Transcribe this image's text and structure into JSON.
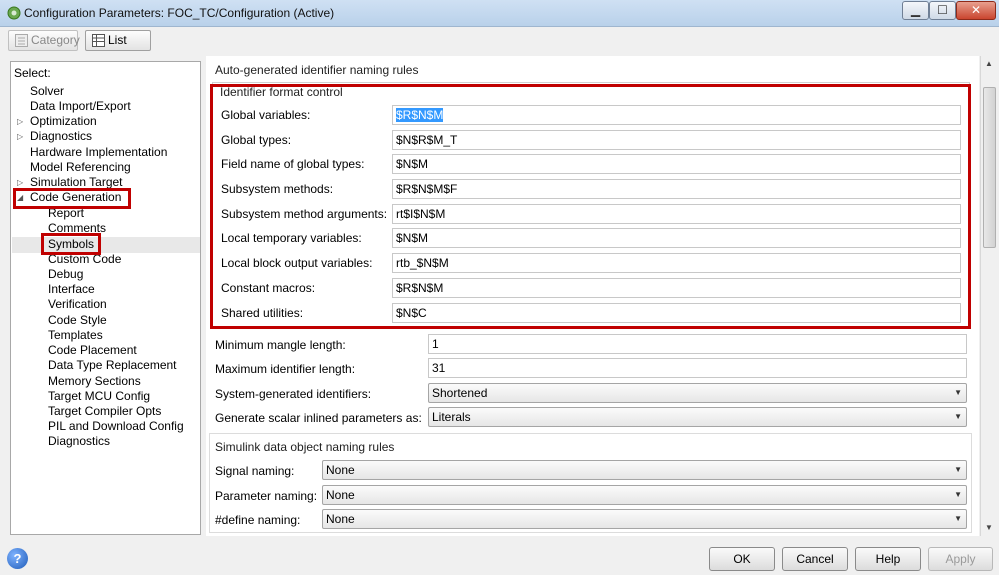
{
  "window": {
    "title": "Configuration Parameters: FOC_TC/Configuration (Active)",
    "minimize": "▁",
    "maximize": "☐",
    "close": "✕"
  },
  "toolbar": {
    "category_label": "Category",
    "list_label": "List"
  },
  "tree": {
    "select_label": "Select:",
    "items": [
      "Solver",
      "Data Import/Export",
      "Optimization",
      "Diagnostics",
      "Hardware Implementation",
      "Model Referencing",
      "Simulation Target",
      "Code Generation",
      "Report",
      "Comments",
      "Symbols",
      "Custom Code",
      "Debug",
      "Interface",
      "Verification",
      "Code Style",
      "Templates",
      "Code Placement",
      "Data Type Replacement",
      "Memory Sections",
      "Target MCU Config",
      "Target Compiler Opts",
      "PIL and Download Config",
      "Diagnostics"
    ],
    "selected": "Symbols"
  },
  "main": {
    "auto_title": "Auto-generated identifier naming rules",
    "format_group_title": "Identifier format control",
    "format_rows": [
      {
        "label": "Global variables:",
        "value": "$R$N$M"
      },
      {
        "label": "Global types:",
        "value": "$N$R$M_T"
      },
      {
        "label": "Field name of global types:",
        "value": "$N$M"
      },
      {
        "label": "Subsystem methods:",
        "value": "$R$N$M$F"
      },
      {
        "label": "Subsystem method arguments:",
        "value": "rt$I$N$M"
      },
      {
        "label": "Local temporary variables:",
        "value": "$N$M"
      },
      {
        "label": "Local block output variables:",
        "value": "rtb_$N$M"
      },
      {
        "label": "Constant macros:",
        "value": "$R$N$M"
      },
      {
        "label": "Shared utilities:",
        "value": "$N$C"
      }
    ],
    "min_mangle_label": "Minimum mangle length:",
    "min_mangle_value": "1",
    "max_id_label": "Maximum identifier length:",
    "max_id_value": "31",
    "sysgen_label": "System-generated identifiers:",
    "sysgen_value": "Shortened",
    "scalar_label": "Generate scalar inlined parameters as:",
    "scalar_value": "Literals",
    "simulink_title": "Simulink data object naming rules",
    "signal_label": "Signal naming:",
    "signal_value": "None",
    "param_label": "Parameter naming:",
    "param_value": "None",
    "define_label": "#define naming:",
    "define_value": "None"
  },
  "buttons": {
    "help_icon": "?",
    "ok": "OK",
    "cancel": "Cancel",
    "help": "Help",
    "apply": "Apply"
  },
  "colors": {
    "highlight": "#c00000",
    "selection": "#3399ff"
  }
}
